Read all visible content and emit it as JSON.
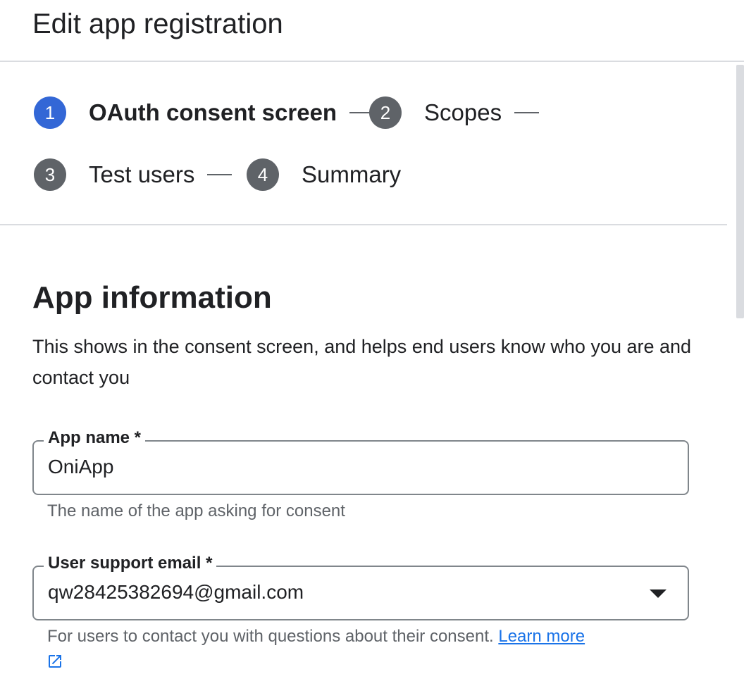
{
  "header": {
    "title": "Edit app registration"
  },
  "stepper": {
    "steps": [
      {
        "number": "1",
        "label": "OAuth consent screen",
        "active": true
      },
      {
        "number": "2",
        "label": "Scopes",
        "active": false
      },
      {
        "number": "3",
        "label": "Test users",
        "active": false
      },
      {
        "number": "4",
        "label": "Summary",
        "active": false
      }
    ]
  },
  "app_info": {
    "title": "App information",
    "description": "This shows in the consent screen, and helps end users know who you are and contact you"
  },
  "fields": {
    "app_name": {
      "label": "App name *",
      "value": "OniApp",
      "helper": "The name of the app asking for consent"
    },
    "support_email": {
      "label": "User support email *",
      "value": "qw28425382694@gmail.com",
      "helper": "For users to contact you with questions about their consent.",
      "learn_more": "Learn more"
    }
  },
  "colors": {
    "accent": "#3367d6",
    "link": "#1a73e8",
    "step_inactive": "#5f6368",
    "border": "#80868b"
  },
  "icons": {
    "dropdown": "arrow-drop-down-icon",
    "external": "open-in-new-icon"
  }
}
